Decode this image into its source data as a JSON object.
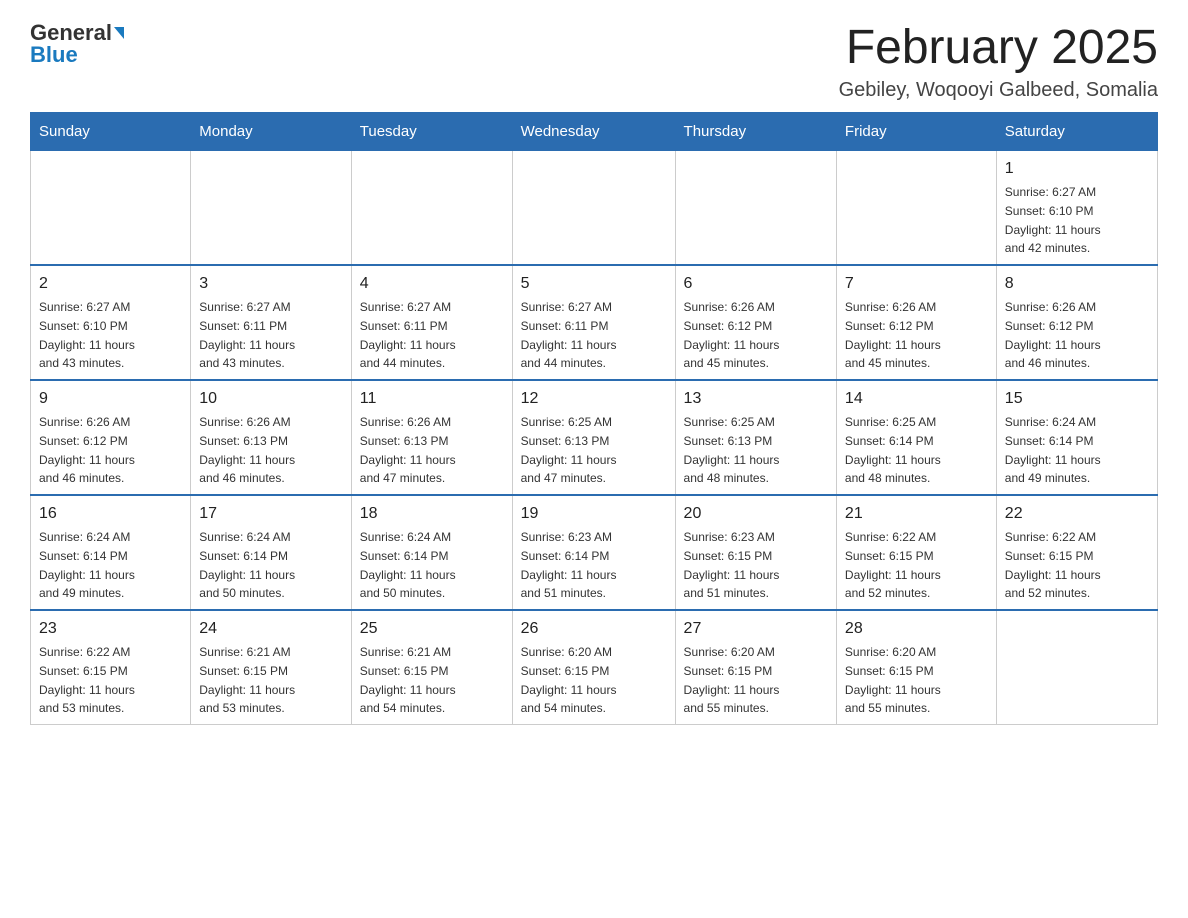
{
  "header": {
    "logo_line1": "General",
    "logo_line2": "Blue",
    "title": "February 2025",
    "subtitle": "Gebiley, Woqooyi Galbeed, Somalia"
  },
  "weekdays": [
    "Sunday",
    "Monday",
    "Tuesday",
    "Wednesday",
    "Thursday",
    "Friday",
    "Saturday"
  ],
  "weeks": [
    [
      {
        "day": "",
        "info": ""
      },
      {
        "day": "",
        "info": ""
      },
      {
        "day": "",
        "info": ""
      },
      {
        "day": "",
        "info": ""
      },
      {
        "day": "",
        "info": ""
      },
      {
        "day": "",
        "info": ""
      },
      {
        "day": "1",
        "info": "Sunrise: 6:27 AM\nSunset: 6:10 PM\nDaylight: 11 hours\nand 42 minutes."
      }
    ],
    [
      {
        "day": "2",
        "info": "Sunrise: 6:27 AM\nSunset: 6:10 PM\nDaylight: 11 hours\nand 43 minutes."
      },
      {
        "day": "3",
        "info": "Sunrise: 6:27 AM\nSunset: 6:11 PM\nDaylight: 11 hours\nand 43 minutes."
      },
      {
        "day": "4",
        "info": "Sunrise: 6:27 AM\nSunset: 6:11 PM\nDaylight: 11 hours\nand 44 minutes."
      },
      {
        "day": "5",
        "info": "Sunrise: 6:27 AM\nSunset: 6:11 PM\nDaylight: 11 hours\nand 44 minutes."
      },
      {
        "day": "6",
        "info": "Sunrise: 6:26 AM\nSunset: 6:12 PM\nDaylight: 11 hours\nand 45 minutes."
      },
      {
        "day": "7",
        "info": "Sunrise: 6:26 AM\nSunset: 6:12 PM\nDaylight: 11 hours\nand 45 minutes."
      },
      {
        "day": "8",
        "info": "Sunrise: 6:26 AM\nSunset: 6:12 PM\nDaylight: 11 hours\nand 46 minutes."
      }
    ],
    [
      {
        "day": "9",
        "info": "Sunrise: 6:26 AM\nSunset: 6:12 PM\nDaylight: 11 hours\nand 46 minutes."
      },
      {
        "day": "10",
        "info": "Sunrise: 6:26 AM\nSunset: 6:13 PM\nDaylight: 11 hours\nand 46 minutes."
      },
      {
        "day": "11",
        "info": "Sunrise: 6:26 AM\nSunset: 6:13 PM\nDaylight: 11 hours\nand 47 minutes."
      },
      {
        "day": "12",
        "info": "Sunrise: 6:25 AM\nSunset: 6:13 PM\nDaylight: 11 hours\nand 47 minutes."
      },
      {
        "day": "13",
        "info": "Sunrise: 6:25 AM\nSunset: 6:13 PM\nDaylight: 11 hours\nand 48 minutes."
      },
      {
        "day": "14",
        "info": "Sunrise: 6:25 AM\nSunset: 6:14 PM\nDaylight: 11 hours\nand 48 minutes."
      },
      {
        "day": "15",
        "info": "Sunrise: 6:24 AM\nSunset: 6:14 PM\nDaylight: 11 hours\nand 49 minutes."
      }
    ],
    [
      {
        "day": "16",
        "info": "Sunrise: 6:24 AM\nSunset: 6:14 PM\nDaylight: 11 hours\nand 49 minutes."
      },
      {
        "day": "17",
        "info": "Sunrise: 6:24 AM\nSunset: 6:14 PM\nDaylight: 11 hours\nand 50 minutes."
      },
      {
        "day": "18",
        "info": "Sunrise: 6:24 AM\nSunset: 6:14 PM\nDaylight: 11 hours\nand 50 minutes."
      },
      {
        "day": "19",
        "info": "Sunrise: 6:23 AM\nSunset: 6:14 PM\nDaylight: 11 hours\nand 51 minutes."
      },
      {
        "day": "20",
        "info": "Sunrise: 6:23 AM\nSunset: 6:15 PM\nDaylight: 11 hours\nand 51 minutes."
      },
      {
        "day": "21",
        "info": "Sunrise: 6:22 AM\nSunset: 6:15 PM\nDaylight: 11 hours\nand 52 minutes."
      },
      {
        "day": "22",
        "info": "Sunrise: 6:22 AM\nSunset: 6:15 PM\nDaylight: 11 hours\nand 52 minutes."
      }
    ],
    [
      {
        "day": "23",
        "info": "Sunrise: 6:22 AM\nSunset: 6:15 PM\nDaylight: 11 hours\nand 53 minutes."
      },
      {
        "day": "24",
        "info": "Sunrise: 6:21 AM\nSunset: 6:15 PM\nDaylight: 11 hours\nand 53 minutes."
      },
      {
        "day": "25",
        "info": "Sunrise: 6:21 AM\nSunset: 6:15 PM\nDaylight: 11 hours\nand 54 minutes."
      },
      {
        "day": "26",
        "info": "Sunrise: 6:20 AM\nSunset: 6:15 PM\nDaylight: 11 hours\nand 54 minutes."
      },
      {
        "day": "27",
        "info": "Sunrise: 6:20 AM\nSunset: 6:15 PM\nDaylight: 11 hours\nand 55 minutes."
      },
      {
        "day": "28",
        "info": "Sunrise: 6:20 AM\nSunset: 6:15 PM\nDaylight: 11 hours\nand 55 minutes."
      },
      {
        "day": "",
        "info": ""
      }
    ]
  ]
}
